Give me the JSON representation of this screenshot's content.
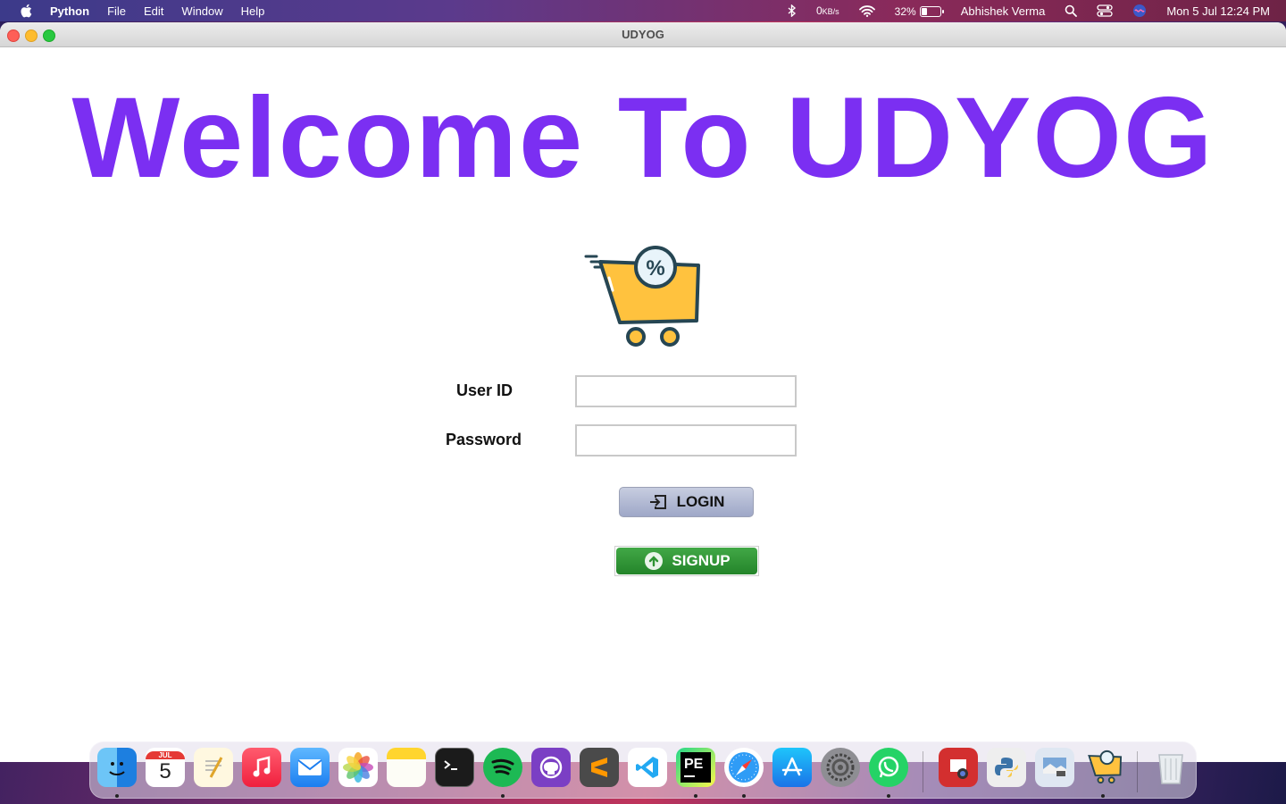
{
  "menubar": {
    "app_name": "Python",
    "menus": [
      "File",
      "Edit",
      "Window",
      "Help"
    ],
    "network_value": "0",
    "network_unit": "KB/s",
    "battery_percent": "32%",
    "user_name": "Abhishek Verma",
    "datetime": "Mon 5 Jul  12:24 PM"
  },
  "window": {
    "title": "UDYOG"
  },
  "main": {
    "heading": "Welcome To UDYOG",
    "cart_badge": "%",
    "user_id_label": "User ID",
    "user_id_value": "",
    "password_label": "Password",
    "password_value": "",
    "login_label": "LOGIN",
    "signup_label": "SIGNUP"
  },
  "colors": {
    "heading": "#7b2ff2",
    "signup": "#2e9433",
    "login": "#aab2cf"
  },
  "dock": {
    "calendar_month": "JUL",
    "calendar_day": "5",
    "pycharm_label": "PE",
    "apps": [
      "finder-icon",
      "calendar-icon",
      "textedit-icon",
      "music-icon",
      "mail-icon",
      "photos-icon",
      "notes-icon",
      "terminal-icon",
      "spotify-icon",
      "github-desktop-icon",
      "sublime-text-icon",
      "vscode-icon",
      "pycharm-icon",
      "safari-icon",
      "app-store-icon",
      "system-preferences-icon",
      "whatsapp-icon",
      "photo-booth-icon",
      "python-launcher-icon",
      "preview-icon",
      "udyog-cart-icon",
      "trash-icon"
    ]
  }
}
